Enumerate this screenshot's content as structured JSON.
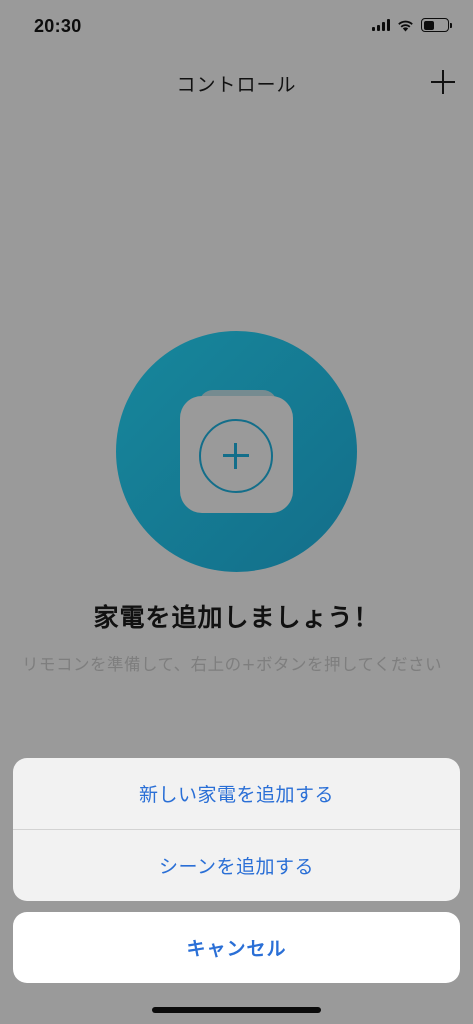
{
  "status_bar": {
    "time": "20:30",
    "icons": [
      "signal-icon",
      "wifi-icon",
      "battery-icon"
    ],
    "battery_level": 0.45
  },
  "nav": {
    "title": "コントロール",
    "add_icon": "plus-icon"
  },
  "empty_state": {
    "illustration_icon": "add-appliance-icon",
    "title": "家電を追加しましょう！",
    "description": "リモコンを準備して、右上の+ボタンを押してください"
  },
  "action_sheet": {
    "options": [
      "新しい家電を追加する",
      "シーンを追加する"
    ],
    "cancel": "キャンセル"
  },
  "colors": {
    "accent": "#2a6fd6",
    "hero": "#17879c",
    "overlay_background": "#9a9a9a"
  }
}
